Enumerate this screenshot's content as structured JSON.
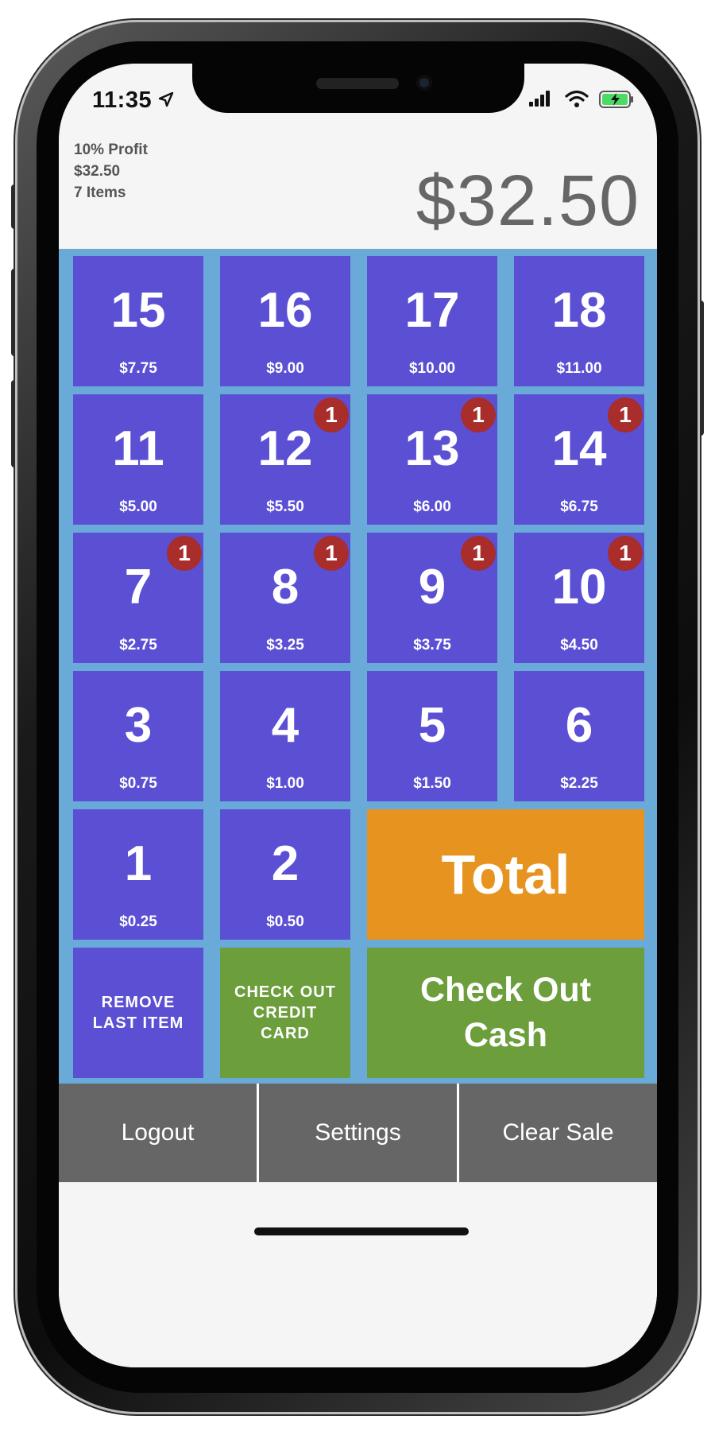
{
  "status_bar": {
    "time": "11:35"
  },
  "header": {
    "profit_label": "10% Profit",
    "subtotal": "$32.50",
    "item_count": "7 Items",
    "total_display": "$32.50"
  },
  "items": [
    {
      "number": "15",
      "price": "$7.75",
      "badge": ""
    },
    {
      "number": "16",
      "price": "$9.00",
      "badge": ""
    },
    {
      "number": "17",
      "price": "$10.00",
      "badge": ""
    },
    {
      "number": "18",
      "price": "$11.00",
      "badge": ""
    },
    {
      "number": "11",
      "price": "$5.00",
      "badge": ""
    },
    {
      "number": "12",
      "price": "$5.50",
      "badge": "1"
    },
    {
      "number": "13",
      "price": "$6.00",
      "badge": "1"
    },
    {
      "number": "14",
      "price": "$6.75",
      "badge": "1"
    },
    {
      "number": "7",
      "price": "$2.75",
      "badge": "1"
    },
    {
      "number": "8",
      "price": "$3.25",
      "badge": "1"
    },
    {
      "number": "9",
      "price": "$3.75",
      "badge": "1"
    },
    {
      "number": "10",
      "price": "$4.50",
      "badge": "1"
    },
    {
      "number": "3",
      "price": "$0.75",
      "badge": ""
    },
    {
      "number": "4",
      "price": "$1.00",
      "badge": ""
    },
    {
      "number": "5",
      "price": "$1.50",
      "badge": ""
    },
    {
      "number": "6",
      "price": "$2.25",
      "badge": ""
    },
    {
      "number": "1",
      "price": "$0.25",
      "badge": ""
    },
    {
      "number": "2",
      "price": "$0.50",
      "badge": ""
    }
  ],
  "actions": {
    "total_label": "Total",
    "remove_last_line1": "REMOVE",
    "remove_last_line2": "LAST ITEM",
    "credit_line1": "CHECK OUT",
    "credit_line2": "CREDIT",
    "credit_line3": "CARD",
    "cash_line1": "Check Out",
    "cash_line2": "Cash"
  },
  "bottom_nav": {
    "logout": "Logout",
    "settings": "Settings",
    "clear_sale": "Clear Sale"
  },
  "colors": {
    "tile": "#5b4fd4",
    "grid_background": "#6aaad8",
    "badge": "#a82d2b",
    "total_button": "#e69320",
    "checkout_button": "#6c9e3c",
    "bottom_bar": "#666666"
  }
}
